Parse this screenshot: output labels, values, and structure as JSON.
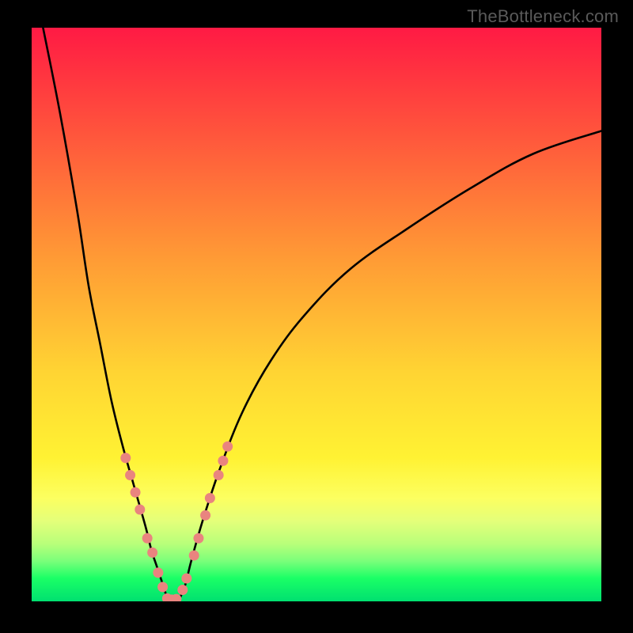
{
  "watermark": "TheBottleneck.com",
  "colors": {
    "background": "#000000",
    "curve": "#000000",
    "marker": "#e9847f"
  },
  "chart_data": {
    "type": "line",
    "title": "",
    "xlabel": "",
    "ylabel": "",
    "xlim": [
      0,
      100
    ],
    "ylim": [
      0,
      100
    ],
    "grid": false,
    "legend": false,
    "series": [
      {
        "name": "left-curve",
        "x": [
          2,
          5,
          8,
          10,
          12,
          14,
          16,
          18,
          20,
          21,
          22,
          23,
          23.8
        ],
        "values": [
          100,
          85,
          68,
          55,
          45,
          35,
          27,
          20,
          13,
          9,
          6,
          3,
          0.5
        ]
      },
      {
        "name": "right-curve",
        "x": [
          26,
          27,
          28,
          30,
          33,
          37,
          42,
          48,
          56,
          66,
          77,
          88,
          100
        ],
        "values": [
          0.5,
          3,
          7,
          14,
          23,
          33,
          42,
          50,
          58,
          65,
          72,
          78,
          82
        ]
      },
      {
        "name": "valley-floor",
        "x": [
          23.8,
          24.5,
          25.3,
          26
        ],
        "values": [
          0.5,
          0.2,
          0.2,
          0.5
        ]
      }
    ],
    "markers": [
      {
        "series": "left-curve",
        "x": 16.5,
        "y": 25
      },
      {
        "series": "left-curve",
        "x": 17.3,
        "y": 22
      },
      {
        "series": "left-curve",
        "x": 18.2,
        "y": 19
      },
      {
        "series": "left-curve",
        "x": 19.0,
        "y": 16
      },
      {
        "series": "left-curve",
        "x": 20.3,
        "y": 11
      },
      {
        "series": "left-curve",
        "x": 21.2,
        "y": 8.5
      },
      {
        "series": "left-curve",
        "x": 22.2,
        "y": 5
      },
      {
        "series": "left-curve",
        "x": 23.0,
        "y": 2.5
      },
      {
        "series": "valley-floor",
        "x": 23.8,
        "y": 0.5
      },
      {
        "series": "valley-floor",
        "x": 24.6,
        "y": 0.3
      },
      {
        "series": "valley-floor",
        "x": 25.4,
        "y": 0.4
      },
      {
        "series": "right-curve",
        "x": 26.5,
        "y": 2
      },
      {
        "series": "right-curve",
        "x": 27.2,
        "y": 4
      },
      {
        "series": "right-curve",
        "x": 28.5,
        "y": 8
      },
      {
        "series": "right-curve",
        "x": 29.3,
        "y": 11
      },
      {
        "series": "right-curve",
        "x": 30.5,
        "y": 15
      },
      {
        "series": "right-curve",
        "x": 31.3,
        "y": 18
      },
      {
        "series": "right-curve",
        "x": 32.8,
        "y": 22
      },
      {
        "series": "right-curve",
        "x": 33.6,
        "y": 24.5
      },
      {
        "series": "right-curve",
        "x": 34.4,
        "y": 27
      }
    ]
  }
}
